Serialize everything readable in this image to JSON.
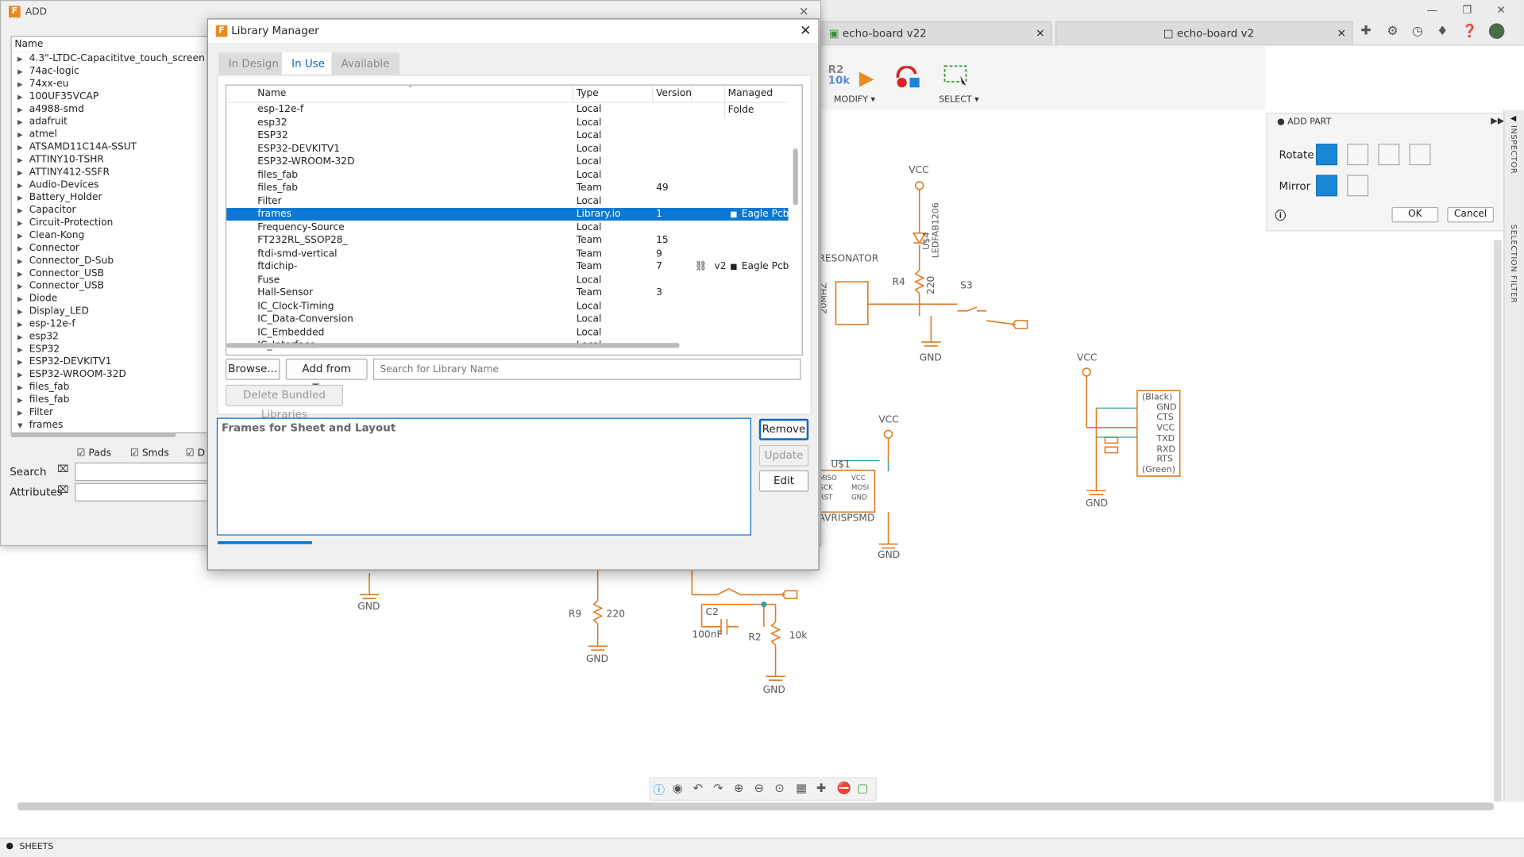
{
  "add_window": {
    "title": "ADD",
    "column_header": "Name",
    "libraries": [
      "4.3\"-LTDC-Capacititve_touch_screen",
      "74ac-logic",
      "74xx-eu",
      "100UF35VCAP",
      "a4988-smd",
      "adafruit",
      "atmel",
      "ATSAMD11C14A-SSUT",
      "ATTINY10-TSHR",
      "ATTINY412-SSFR",
      "Audio-Devices",
      "Battery_Holder",
      "Capacitor",
      "Circuit-Protection",
      "Clean-Kong",
      "Connector",
      "Connector_D-Sub",
      "Connector_USB",
      "Connector_USB",
      "Diode",
      "Display_LED",
      "esp-12e-f",
      "esp32",
      "ESP32",
      "ESP32-DEVKITV1",
      "ESP32-WROOM-32D",
      "files_fab",
      "files_fab",
      "Filter",
      "frames"
    ],
    "filters": {
      "pads": "Pads",
      "smds": "Smds",
      "d": "D"
    },
    "search_label": "Search",
    "attributes_label": "Attributes"
  },
  "tabs": [
    {
      "label": "echo-board v22"
    },
    {
      "label": "echo-board v2"
    }
  ],
  "ribbon": {
    "modify_label": "MODIFY ▾",
    "select_label": "SELECT ▾",
    "r2": "R2",
    "r2_value": "10k"
  },
  "dialog": {
    "title": "Library Manager",
    "tabs": [
      "In Design",
      "In Use",
      "Available"
    ],
    "columns": {
      "name": "Name",
      "type": "Type",
      "version": "Version",
      "managed": "Managed Folde"
    },
    "rows": [
      {
        "name": "esp-12e-f",
        "type": "Local",
        "version": "",
        "link": "",
        "managed": ""
      },
      {
        "name": "esp32",
        "type": "Local",
        "version": "",
        "link": "",
        "managed": ""
      },
      {
        "name": "ESP32",
        "type": "Local",
        "version": "",
        "link": "",
        "managed": ""
      },
      {
        "name": "ESP32-DEVKITV1",
        "type": "Local",
        "version": "",
        "link": "",
        "managed": ""
      },
      {
        "name": "ESP32-WROOM-32D",
        "type": "Local",
        "version": "",
        "link": "",
        "managed": ""
      },
      {
        "name": "files_fab",
        "type": "Local",
        "version": "",
        "link": "",
        "managed": ""
      },
      {
        "name": "files_fab",
        "type": "Team",
        "version": "49",
        "link": "",
        "managed": ""
      },
      {
        "name": "Filter",
        "type": "Local",
        "version": "",
        "link": "",
        "managed": ""
      },
      {
        "name": "frames",
        "type": "Library.io",
        "version": "1",
        "link": "",
        "managed": "Eagle Pcb",
        "selected": true
      },
      {
        "name": "Frequency-Source",
        "type": "Local",
        "version": "",
        "link": "",
        "managed": ""
      },
      {
        "name": "FT232RL_SSOP28_",
        "type": "Team",
        "version": "15",
        "link": "",
        "managed": ""
      },
      {
        "name": "ftdi-smd-vertical",
        "type": "Team",
        "version": "9",
        "link": "",
        "managed": ""
      },
      {
        "name": "ftdichip-",
        "type": "Team",
        "version": "7",
        "link": "v2",
        "managed": "Eagle Pcb"
      },
      {
        "name": "Fuse",
        "type": "Local",
        "version": "",
        "link": "",
        "managed": ""
      },
      {
        "name": "Hall-Sensor",
        "type": "Team",
        "version": "3",
        "link": "",
        "managed": ""
      },
      {
        "name": "IC_Clock-Timing",
        "type": "Local",
        "version": "",
        "link": "",
        "managed": ""
      },
      {
        "name": "IC_Data-Conversion",
        "type": "Local",
        "version": "",
        "link": "",
        "managed": ""
      },
      {
        "name": "IC_Embedded",
        "type": "Local",
        "version": "",
        "link": "",
        "managed": ""
      },
      {
        "name": "IC_Interface",
        "type": "Local",
        "version": "",
        "link": "",
        "managed": ""
      }
    ],
    "browse": "Browse...",
    "add_from_team": "Add from Team",
    "search_placeholder": "Search for Library Name",
    "delete_bundled": "Delete Bundled Libraries",
    "description": "Frames for Sheet and Layout",
    "remove": "Remove",
    "update": "Update",
    "edit": "Edit"
  },
  "inspector": {
    "title": "ADD PART",
    "rotate": "Rotate",
    "mirror": "Mirror",
    "ok": "OK",
    "cancel": "Cancel",
    "side_inspector": "INSPECTOR",
    "side_filter": "SELECTION FILTER"
  },
  "schematic": {
    "vcc": "VCC",
    "gnd": "GND",
    "resonator": "RESONATOR",
    "r4": "R4",
    "v220": "220",
    "u4": "U$4",
    "led": "LEDFAB1206",
    "mhz": "20MHZ",
    "s3": "S3",
    "u1": "U$1",
    "avr": "AVRISPSMD",
    "r9": "R9",
    "r2": "R2",
    "c2": "C2",
    "c_val": "100nF",
    "r_val": "10k",
    "ftdi_pins": [
      "(Black)",
      "GND",
      "CTS",
      "VCC",
      "TXD",
      "RXD",
      "RTS",
      "(Green)"
    ],
    "isp_pins": [
      "MISO",
      "SCK",
      "RST",
      "VCC",
      "MOSI",
      "GND"
    ]
  },
  "status": {
    "sheets": "SHEETS"
  }
}
